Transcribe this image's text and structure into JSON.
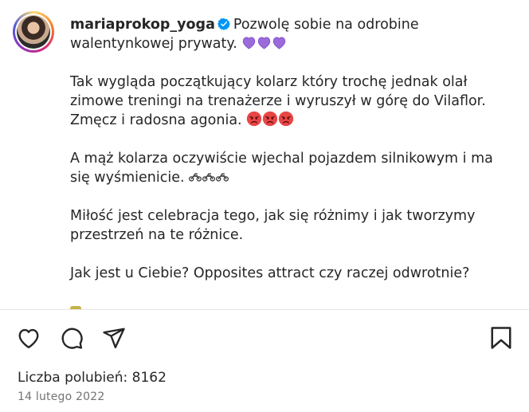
{
  "post": {
    "username": "mariaprokop_yoga",
    "verified": true,
    "caption_first": "Pozwolę sobie na odrobine walentynkowej prywaty.",
    "paragraph_2": "Tak wygląda początkujący kolarz który trochę jednak olał zimowe treningi na trenażerze i wyruszył w górę do Vilaflor. Zmęcz i radosna agonia.",
    "paragraph_3": "A mąż kolarza oczywiście wjechal pojazdem silnikowym i ma się wyśmienicie.",
    "paragraph_4": "Miłość jest celebracja tego, jak się różnimy i jak tworzymy przestrzeń na te różnice.",
    "paragraph_5": "Jak jest u Ciebie? Opposites attract czy raczej odwrotnie?",
    "emoji": {
      "hearts": [
        "purple-heart",
        "purple-heart",
        "purple-heart"
      ],
      "angry": [
        "enraged-face",
        "enraged-face",
        "enraged-face"
      ],
      "motorcycles": [
        "motorcycle",
        "motorcycle",
        "motorcycle"
      ]
    }
  },
  "footer": {
    "likes_label": "Liczba polubień: 8162",
    "date": "14 lutego 2022"
  },
  "icons": [
    "like-heart-icon",
    "comment-icon",
    "share-icon",
    "bookmark-icon"
  ],
  "colors": {
    "text": "#262626",
    "secondary": "#737373",
    "verified": "#0095f6",
    "heart": "#8e5ae8"
  }
}
